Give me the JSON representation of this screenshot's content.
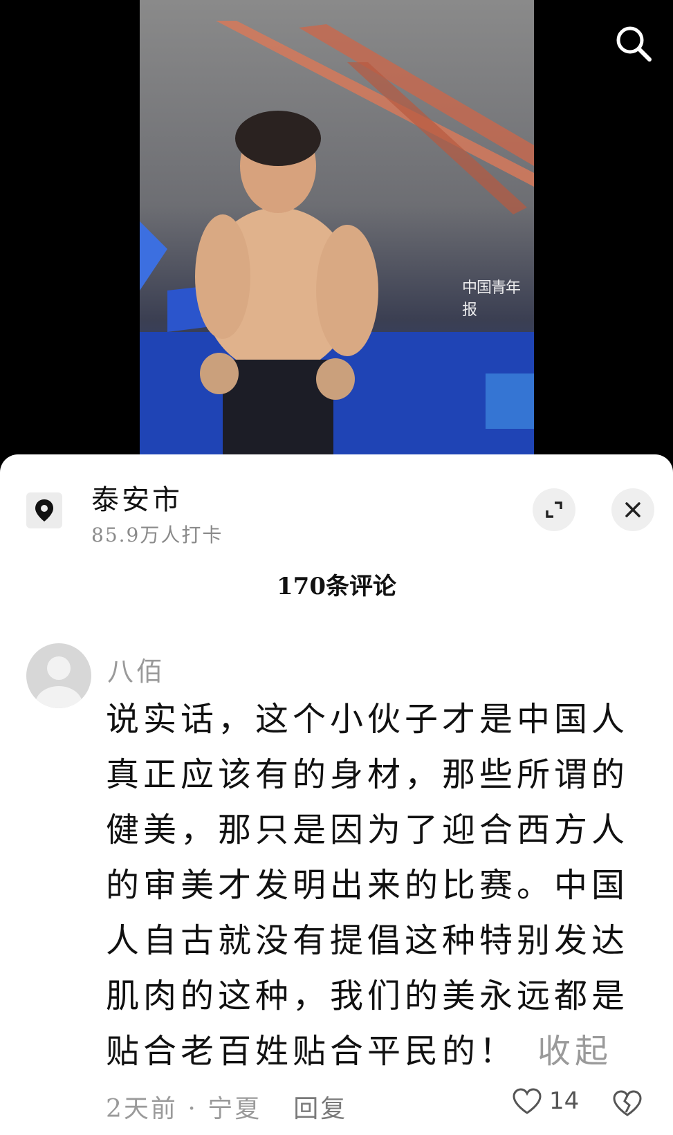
{
  "video": {
    "watermark": "中国青年报"
  },
  "location": {
    "name": "泰安市",
    "checkins": "85.9万人打卡"
  },
  "comments_header": {
    "title": "170条评论"
  },
  "comment": {
    "username": "八佰",
    "text": "说实话，这个小伙子才是中国人真正应该有的身材，那些所谓的健美，那只是因为了迎合西方人的审美才发明出来的比赛。中国人自古就没有提倡这种特别发达肌肉的这种，我们的美永远都是贴合老百姓贴合平民的！",
    "collapse_label": "收起",
    "time_location": "2天前 · 宁夏",
    "reply_label": "回复",
    "likes": "14"
  },
  "icons": {
    "search": "search-icon",
    "location": "location-pin-icon",
    "expand": "expand-icon",
    "close": "close-icon",
    "like": "heart-icon",
    "dislike": "broken-heart-icon"
  }
}
